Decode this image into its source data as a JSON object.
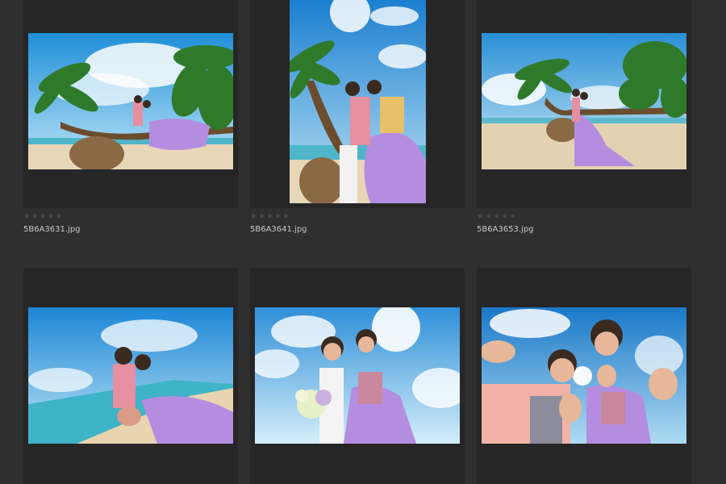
{
  "rating_max": 5,
  "star_glyph": "★",
  "star_color": "#4a4a4a",
  "thumbnails": [
    {
      "filename": "5B6A3631.jpg",
      "rating": 0,
      "scene": "couple-on-palm-tree-beach"
    },
    {
      "filename": "5B6A3641.jpg",
      "rating": 0,
      "scene": "couple-on-palm-tree-portrait"
    },
    {
      "filename": "5B6A3653.jpg",
      "rating": 0,
      "scene": "couple-standing-beach-palms"
    },
    {
      "filename": "",
      "rating": null,
      "scene": "couple-selfie-beach"
    },
    {
      "filename": "",
      "rating": null,
      "scene": "couple-with-bouquet-sky"
    },
    {
      "filename": "",
      "rating": null,
      "scene": "couple-peace-sign-sky"
    }
  ]
}
